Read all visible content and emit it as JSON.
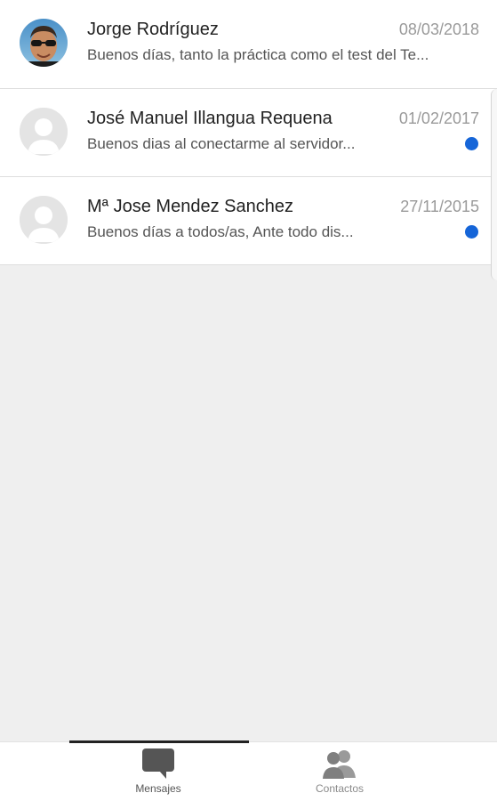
{
  "conversations": [
    {
      "name": "Jorge Rodríguez",
      "date": "08/03/2018",
      "preview": "Buenos días, tanto la práctica como el test del Te...",
      "unread": false,
      "avatar": "photo-avatar"
    },
    {
      "name": "José Manuel Illangua Requena",
      "date": "01/02/2017",
      "preview": "Buenos dias al conectarme al servidor...",
      "unread": true,
      "avatar": "default-avatar"
    },
    {
      "name": "Mª Jose Mendez Sanchez",
      "date": "27/11/2015",
      "preview": "Buenos días a todos/as, Ante todo dis...",
      "unread": true,
      "avatar": "default-avatar"
    }
  ],
  "bottom_nav": {
    "active": "Mensajes",
    "items": [
      {
        "label": "Mensajes",
        "icon": "chat-bubble-icon"
      },
      {
        "label": "Contactos",
        "icon": "contacts-icon"
      }
    ]
  },
  "colors": {
    "unread_dot": "#1565d8",
    "background": "#efefef",
    "active_indicator": "#222222"
  }
}
